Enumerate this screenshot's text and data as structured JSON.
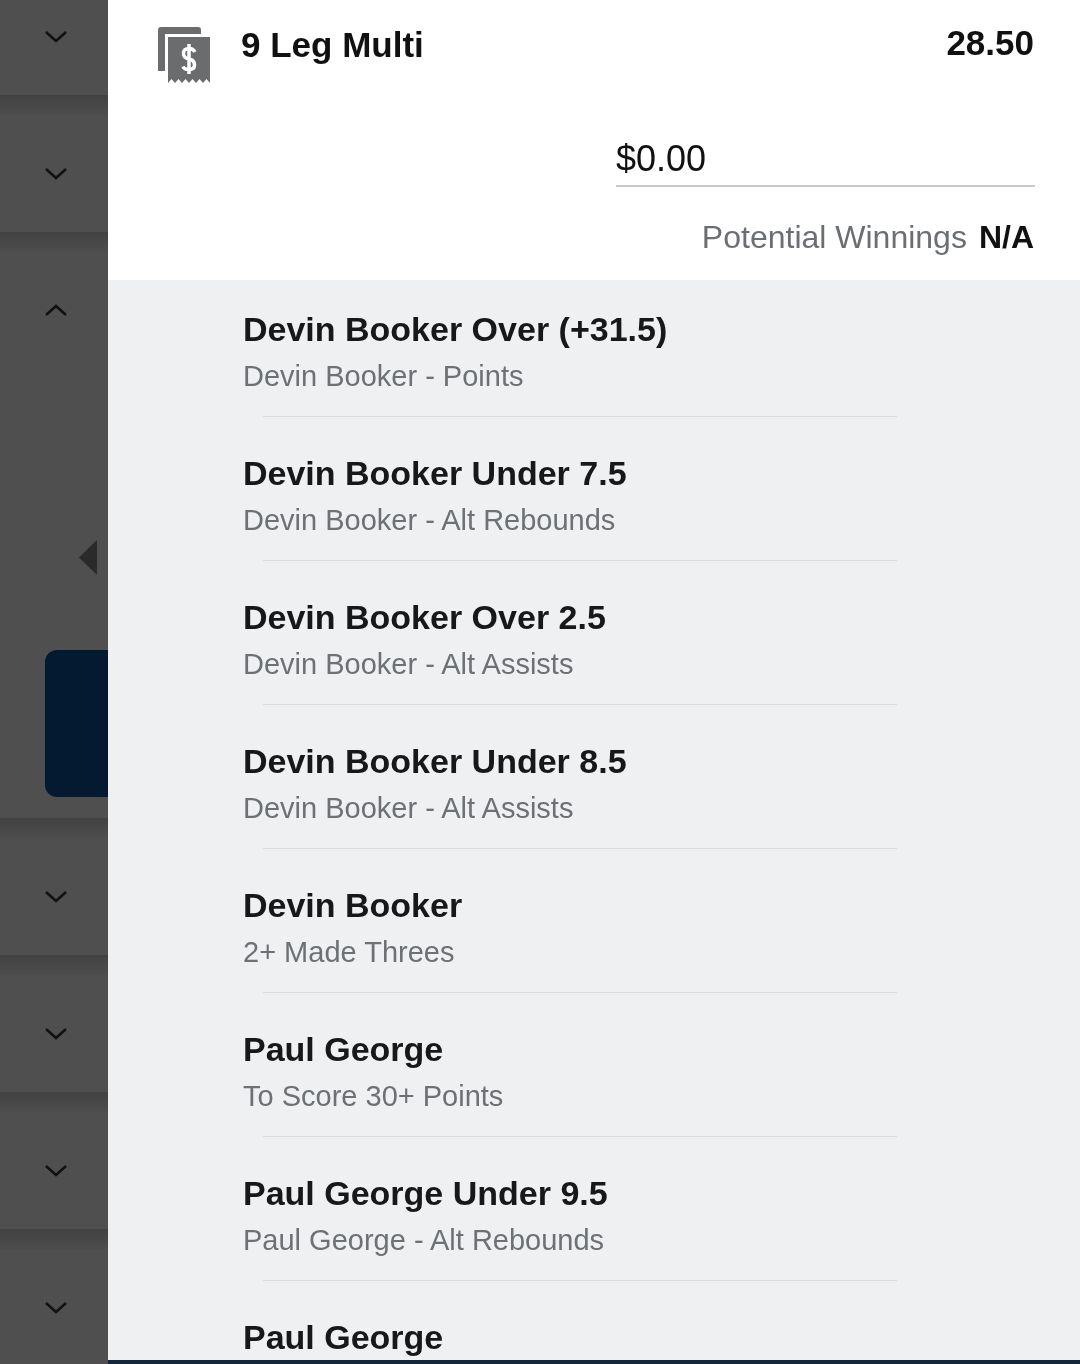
{
  "sidebar": {
    "sections": [
      {
        "expanded": false
      },
      {
        "expanded": false
      },
      {
        "expanded": true
      },
      {
        "expanded": false
      },
      {
        "expanded": false
      },
      {
        "expanded": false
      },
      {
        "expanded": false
      }
    ]
  },
  "bet": {
    "title": "9 Leg Multi",
    "odds": "28.50",
    "stake": {
      "value": "$0.00"
    },
    "potential_winnings": {
      "label": "Potential Winnings",
      "value": "N/A"
    }
  },
  "legs": [
    {
      "selection": "Devin Booker Over (+31.5)",
      "market": "Devin Booker - Points"
    },
    {
      "selection": "Devin Booker Under 7.5",
      "market": "Devin Booker - Alt Rebounds"
    },
    {
      "selection": "Devin Booker Over 2.5",
      "market": "Devin Booker - Alt Assists"
    },
    {
      "selection": "Devin Booker Under 8.5",
      "market": "Devin Booker - Alt Assists"
    },
    {
      "selection": "Devin Booker",
      "market": "2+ Made Threes"
    },
    {
      "selection": "Paul George",
      "market": "To Score 30+ Points"
    },
    {
      "selection": "Paul George Under 9.5",
      "market": "Paul George - Alt Rebounds"
    },
    {
      "selection": "Paul George"
    }
  ]
}
